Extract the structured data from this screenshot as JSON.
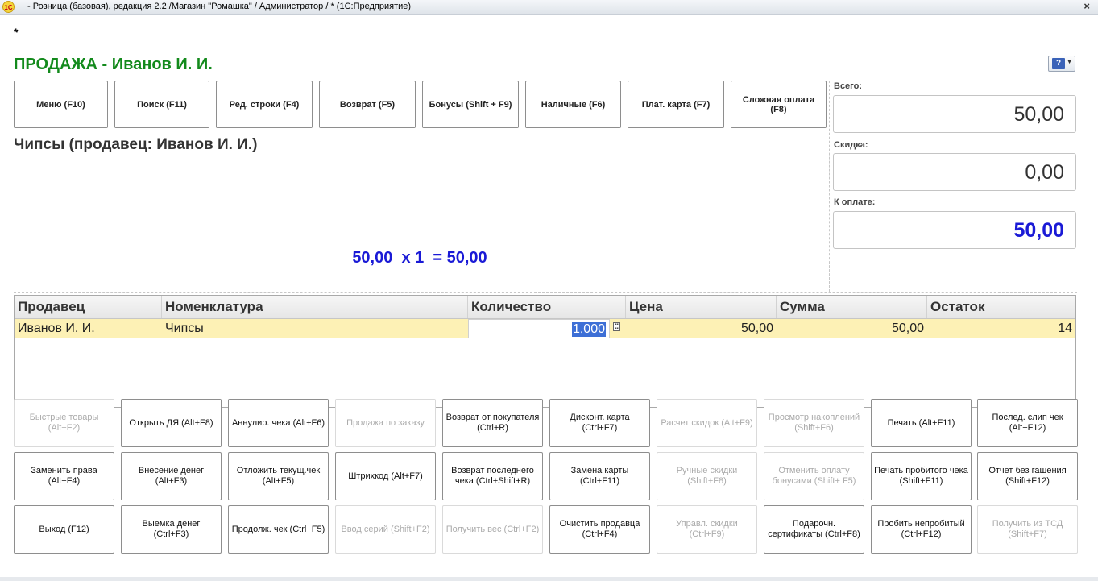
{
  "window": {
    "title": "- Розница (базовая), редакция 2.2 /Магазин \"Ромашка\" / Администратор / * (1С:Предприятие)",
    "logo_text": "1С"
  },
  "form": {
    "modified_mark": "*",
    "title": "ПРОДАЖА - Иванов И. И."
  },
  "toolbar": [
    {
      "label": "Меню (F10)"
    },
    {
      "label": "Поиск (F11)"
    },
    {
      "label": "Ред. строки (F4)"
    },
    {
      "label": "Возврат (F5)"
    },
    {
      "label": "Бонусы (Shift + F9)"
    },
    {
      "label": "Наличные (F6)"
    },
    {
      "label": "Плат. карта (F7)"
    },
    {
      "label": "Сложная оплата (F8)"
    }
  ],
  "current_item": {
    "title": "Чипсы (продавец: Иванов И. И.)",
    "calc": "50,00  х 1  = 50,00"
  },
  "totals": {
    "total_label": "Всего:",
    "total_value": "50,00",
    "discount_label": "Скидка:",
    "discount_value": "0,00",
    "topay_label": "К оплате:",
    "topay_value": "50,00",
    "topay_color": "#1a1ad6"
  },
  "table": {
    "headers": [
      "Продавец",
      "Номенклатура",
      "Количество",
      "Цена",
      "Сумма",
      "Остаток"
    ],
    "rows": [
      {
        "seller": "Иванов И. И.",
        "item": "Чипсы",
        "qty": "1,000",
        "price": "50,00",
        "sum": "50,00",
        "stock": "14"
      }
    ],
    "selected_row_color": "#fdf1b5"
  },
  "buttons": [
    [
      {
        "label": "Быстрые товары (Alt+F2)",
        "enabled": false
      },
      {
        "label": "Открыть ДЯ (Alt+F8)",
        "enabled": true
      },
      {
        "label": "Аннулир. чека (Alt+F6)",
        "enabled": true
      },
      {
        "label": "Продажа по заказу",
        "enabled": false
      },
      {
        "label": "Возврат от покупателя (Ctrl+R)",
        "enabled": true
      },
      {
        "label": "Дисконт. карта (Ctrl+F7)",
        "enabled": true
      },
      {
        "label": "Расчет скидок (Alt+F9)",
        "enabled": false
      },
      {
        "label": "Просмотр накоплений (Shift+F6)",
        "enabled": false
      },
      {
        "label": "Печать (Alt+F11)",
        "enabled": true
      },
      {
        "label": "Послед. слип чек (Alt+F12)",
        "enabled": true
      }
    ],
    [
      {
        "label": "Заменить права (Alt+F4)",
        "enabled": true
      },
      {
        "label": "Внесение денег (Alt+F3)",
        "enabled": true
      },
      {
        "label": "Отложить текущ.чек (Alt+F5)",
        "enabled": true
      },
      {
        "label": "Штрихкод (Alt+F7)",
        "enabled": true
      },
      {
        "label": "Возврат последнего чека (Ctrl+Shift+R)",
        "enabled": true
      },
      {
        "label": "Замена карты (Ctrl+F11)",
        "enabled": true
      },
      {
        "label": "Ручные скидки (Shift+F8)",
        "enabled": false
      },
      {
        "label": "Отменить оплату бонусами (Shift+ F5)",
        "enabled": false
      },
      {
        "label": "Печать пробитого чека (Shift+F11)",
        "enabled": true
      },
      {
        "label": "Отчет без гашения (Shift+F12)",
        "enabled": true
      }
    ],
    [
      {
        "label": "Выход (F12)",
        "enabled": true
      },
      {
        "label": "Выемка денег (Ctrl+F3)",
        "enabled": true
      },
      {
        "label": "Продолж. чек (Ctrl+F5)",
        "enabled": true
      },
      {
        "label": "Ввод серий (Shift+F2)",
        "enabled": false
      },
      {
        "label": "Получить вес (Ctrl+F2)",
        "enabled": false
      },
      {
        "label": "Очистить продавца (Ctrl+F4)",
        "enabled": true
      },
      {
        "label": "Управл. скидки (Ctrl+F9)",
        "enabled": false
      },
      {
        "label": "Подарочн. сертификаты (Ctrl+F8)",
        "enabled": true
      },
      {
        "label": "Пробить непробитый (Ctrl+F12)",
        "enabled": true
      },
      {
        "label": "Получить из ТСД (Shift+F7)",
        "enabled": false
      }
    ]
  ]
}
